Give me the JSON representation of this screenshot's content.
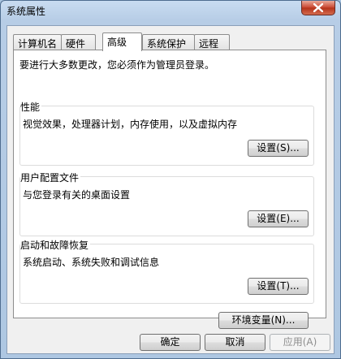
{
  "window": {
    "title": "系统属性"
  },
  "tabs": [
    {
      "label": "计算机名",
      "active": false
    },
    {
      "label": "硬件",
      "active": false
    },
    {
      "label": "高级",
      "active": true
    },
    {
      "label": "系统保护",
      "active": false
    },
    {
      "label": "远程",
      "active": false
    }
  ],
  "panel": {
    "notice": "要进行大多数更改，您必须作为管理员登录。",
    "performance": {
      "title": "性能",
      "desc": "视觉效果，处理器计划，内存使用，以及虚拟内存",
      "button": "设置(S)..."
    },
    "profiles": {
      "title": "用户配置文件",
      "desc": "与您登录有关的桌面设置",
      "button": "设置(E)..."
    },
    "startup": {
      "title": "启动和故障恢复",
      "desc": "系统启动、系统失败和调试信息",
      "button": "设置(T)..."
    },
    "env_button": "环境变量(N)..."
  },
  "footer": {
    "ok": "确定",
    "cancel": "取消",
    "apply": "应用(A)",
    "apply_enabled": false
  },
  "icons": {
    "close": "close-icon"
  },
  "colors": {
    "frame": "#b7cde6",
    "close": "#c8452f"
  }
}
